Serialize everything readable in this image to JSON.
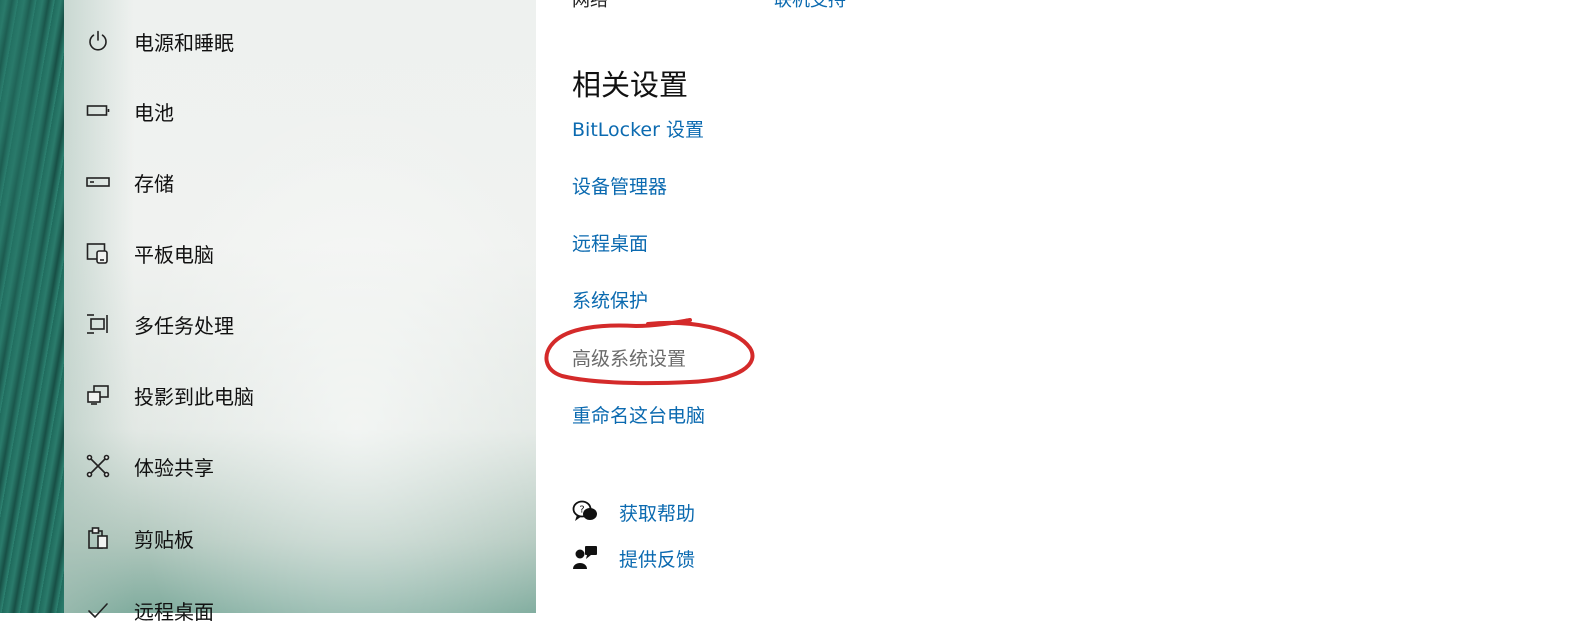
{
  "sidebar": {
    "items": [
      {
        "label": "电源和睡眠",
        "icon": "power-icon"
      },
      {
        "label": "电池",
        "icon": "battery-icon"
      },
      {
        "label": "存储",
        "icon": "storage-icon"
      },
      {
        "label": "平板电脑",
        "icon": "tablet-icon"
      },
      {
        "label": "多任务处理",
        "icon": "multitasking-icon"
      },
      {
        "label": "投影到此电脑",
        "icon": "projecting-icon"
      },
      {
        "label": "体验共享",
        "icon": "shared-experiences-icon"
      },
      {
        "label": "剪贴板",
        "icon": "clipboard-icon"
      },
      {
        "label": "远程桌面",
        "icon": "remote-desktop-icon"
      }
    ]
  },
  "main": {
    "cut_top": {
      "left_text": "网络",
      "right_text": "联机支持"
    },
    "related": {
      "title": "相关设置",
      "links": [
        {
          "label": "BitLocker 设置"
        },
        {
          "label": "设备管理器"
        },
        {
          "label": "远程桌面"
        },
        {
          "label": "系统保护"
        },
        {
          "label": "高级系统设置"
        },
        {
          "label": "重命名这台电脑"
        }
      ]
    },
    "help": {
      "get_help": "获取帮助",
      "give_feedback": "提供反馈"
    }
  },
  "colors": {
    "link": "#0b6ab0",
    "highlight_ring": "#d42a2a",
    "text": "#111111"
  }
}
